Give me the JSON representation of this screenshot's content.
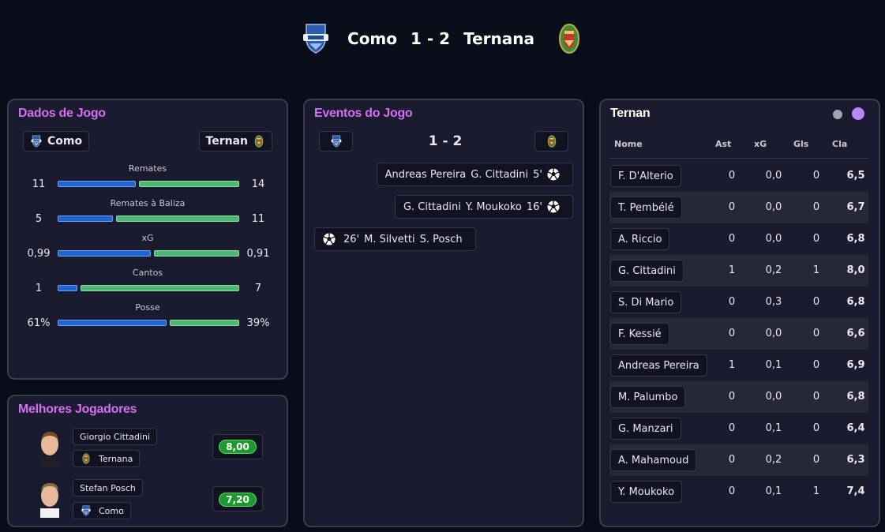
{
  "match": {
    "home": "Como",
    "away": "Ternana",
    "score": "1 - 2"
  },
  "stats_panel": {
    "title": "Dados de Jogo",
    "home_chip": "Como",
    "away_chip": "Ternan",
    "stats": [
      {
        "label": "Remates",
        "home": "11",
        "away": "14",
        "home_frac": 0.44,
        "away_frac": 0.56
      },
      {
        "label": "Remates à Baliza",
        "home": "5",
        "away": "11",
        "home_frac": 0.31,
        "away_frac": 0.69
      },
      {
        "label": "xG",
        "home": "0,99",
        "away": "0,91",
        "home_frac": 0.52,
        "away_frac": 0.48
      },
      {
        "label": "Cantos",
        "home": "1",
        "away": "7",
        "home_frac": 0.11,
        "away_frac": 0.89
      },
      {
        "label": "Posse",
        "home": "61%",
        "away": "39%",
        "home_frac": 0.61,
        "away_frac": 0.39
      }
    ]
  },
  "best_players": {
    "title": "Melhores Jogadores",
    "players": [
      {
        "name": "Giorgio Cittadini",
        "team": "Ternana",
        "rating": "8,00"
      },
      {
        "name": "Stefan Posch",
        "team": "Como",
        "rating": "7,20"
      }
    ]
  },
  "events_panel": {
    "title": "Eventos do Jogo",
    "score": "1 - 2",
    "events": [
      {
        "side": "away",
        "assist": "Andreas Pereira",
        "scorer": "G. Cittadini",
        "minute": "5'"
      },
      {
        "side": "away",
        "assist": "G. Cittadini",
        "scorer": "Y. Moukoko",
        "minute": "16'"
      },
      {
        "side": "home",
        "minute": "26'",
        "scorer": "M. Silvetti",
        "assist": "S. Posch"
      }
    ]
  },
  "table_panel": {
    "title": "Ternan",
    "columns": [
      "Nome",
      "Ast",
      "xG",
      "Gls",
      "Cla"
    ],
    "rows": [
      {
        "name": "F. D'Alterio",
        "ast": "0",
        "xg": "0,0",
        "gls": "0",
        "cla": "6,5"
      },
      {
        "name": "T. Pembélé",
        "ast": "0",
        "xg": "0,0",
        "gls": "0",
        "cla": "6,7"
      },
      {
        "name": "A. Riccio",
        "ast": "0",
        "xg": "0,0",
        "gls": "0",
        "cla": "6,8"
      },
      {
        "name": "G. Cittadini",
        "ast": "1",
        "xg": "0,2",
        "gls": "1",
        "cla": "8,0"
      },
      {
        "name": "S. Di Mario",
        "ast": "0",
        "xg": "0,3",
        "gls": "0",
        "cla": "6,8"
      },
      {
        "name": "F. Kessié",
        "ast": "0",
        "xg": "0,0",
        "gls": "0",
        "cla": "6,6"
      },
      {
        "name": "Andreas Pereira",
        "ast": "1",
        "xg": "0,1",
        "gls": "0",
        "cla": "6,9"
      },
      {
        "name": "M. Palumbo",
        "ast": "0",
        "xg": "0,0",
        "gls": "0",
        "cla": "6,8"
      },
      {
        "name": "G. Manzari",
        "ast": "0",
        "xg": "0,1",
        "gls": "0",
        "cla": "6,4"
      },
      {
        "name": "A. Mahamoud",
        "ast": "0",
        "xg": "0,2",
        "gls": "0",
        "cla": "6,3"
      },
      {
        "name": "Y. Moukoko",
        "ast": "0",
        "xg": "0,1",
        "gls": "1",
        "cla": "7,4"
      }
    ]
  },
  "colors": {
    "accent": "#d56ef2",
    "home_bar": "#1f65d0",
    "away_bar": "#4db873",
    "rating_pill": "#1d9a2e",
    "toggle_active": "#c084fc",
    "toggle_inactive": "#a0a4b0"
  },
  "icons": {
    "home_crest": "como-crest-icon",
    "away_crest": "ternana-crest-icon",
    "goal": "soccer-ball-icon"
  }
}
